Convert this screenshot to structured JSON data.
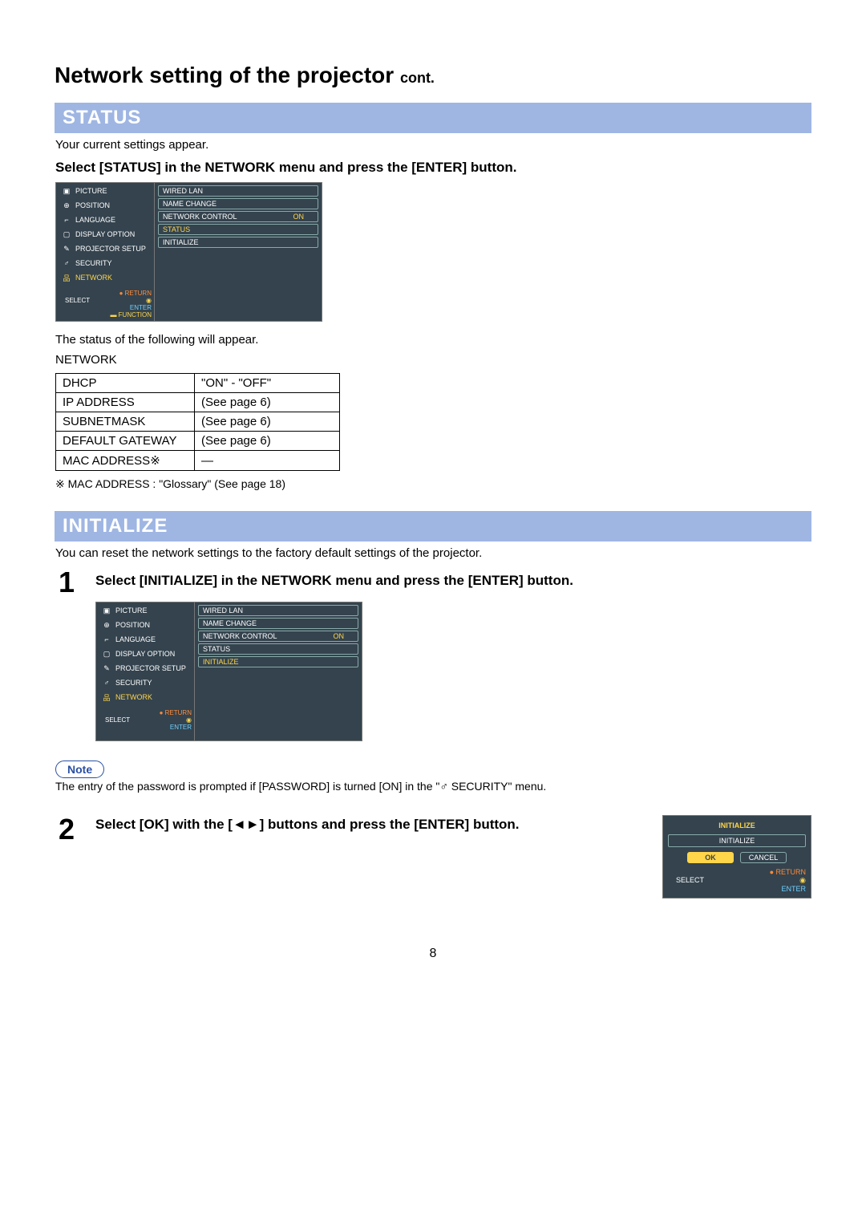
{
  "page": {
    "title": "Network setting of the projector",
    "title_cont": "cont.",
    "number": "8"
  },
  "section_status": {
    "heading": "STATUS",
    "lead": "Your current settings appear.",
    "instruction": "Select [STATUS] in the NETWORK menu and press the [ENTER] button.",
    "status_intro": "The status of the following will appear.",
    "table_caption": "NETWORK",
    "table": [
      {
        "k": "DHCP",
        "v": "\"ON\" - \"OFF\""
      },
      {
        "k": "IP ADDRESS",
        "v": "(See page 6)"
      },
      {
        "k": "SUBNETMASK",
        "v": "(See page 6)"
      },
      {
        "k": "DEFAULT GATEWAY",
        "v": "(See page 6)"
      },
      {
        "k": "MAC ADDRESS※",
        "v": "—"
      }
    ],
    "footnote": "※ MAC ADDRESS : \"Glossary\" (See page 18)"
  },
  "osd": {
    "menu": [
      {
        "icon": "image-icon",
        "label": "PICTURE"
      },
      {
        "icon": "move-icon",
        "label": "POSITION"
      },
      {
        "icon": "globe-icon",
        "label": "LANGUAGE"
      },
      {
        "icon": "display-icon",
        "label": "DISPLAY OPTION"
      },
      {
        "icon": "tool-icon",
        "label": "PROJECTOR SETUP"
      },
      {
        "icon": "lock-icon",
        "label": "SECURITY"
      },
      {
        "icon": "network-icon",
        "label": "NETWORK"
      }
    ],
    "nav": {
      "return": "RETURN",
      "select": "SELECT",
      "enter": "ENTER",
      "function": "FUNCTION"
    },
    "right1": {
      "items": [
        "WIRED LAN",
        "NAME CHANGE"
      ],
      "netctrl": {
        "label": "NETWORK CONTROL",
        "value": "ON"
      },
      "status": "STATUS",
      "init": "INITIALIZE"
    }
  },
  "section_init": {
    "heading": "INITIALIZE",
    "lead": "You can reset the network settings to the factory default settings of the projector.",
    "step1_num": "1",
    "step1_text": "Select [INITIALIZE] in the NETWORK menu and press the [ENTER] button.",
    "note_label": "Note",
    "note_text_a": "The entry of the password is prompted if [PASSWORD] is turned [ON] in the \"",
    "note_text_b": " SECURITY\" menu.",
    "step2_num": "2",
    "step2_text": "Select [OK] with the [◄►] buttons and press the [ENTER] button.",
    "dialog": {
      "title": "INITIALIZE",
      "message": "INITIALIZE",
      "ok": "OK",
      "cancel": "CANCEL",
      "return": "RETURN",
      "select": "SELECT",
      "enter": "ENTER"
    }
  }
}
